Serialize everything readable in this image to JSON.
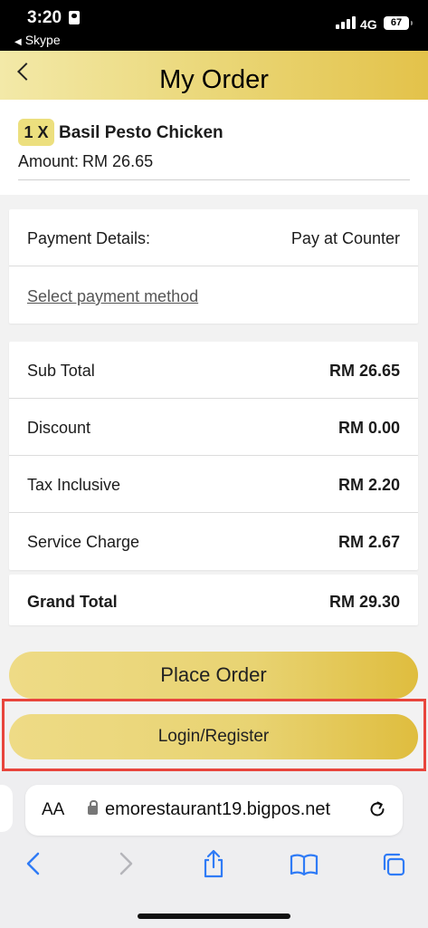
{
  "status_bar": {
    "time": "3:20",
    "back_app": "Skype",
    "network": "4G",
    "battery": "67"
  },
  "header": {
    "title": "My Order"
  },
  "order_item": {
    "quantity": "1 X",
    "name": "Basil Pesto Chicken",
    "amount_label": "Amount:",
    "amount_value": "RM 26.65"
  },
  "payment": {
    "label": "Payment Details:",
    "value": "Pay at Counter",
    "select_link": "Select payment method"
  },
  "summary": [
    {
      "label": "Sub Total",
      "value": "RM 26.65"
    },
    {
      "label": "Discount",
      "value": "RM 0.00"
    },
    {
      "label": "Tax Inclusive",
      "value": "RM 2.20"
    },
    {
      "label": "Service Charge",
      "value": "RM 2.67"
    }
  ],
  "grand_total": {
    "label": "Grand Total",
    "value": "RM 29.30"
  },
  "buttons": {
    "place_order": "Place Order",
    "login_register": "Login/Register"
  },
  "browser": {
    "text_size_label": "AA",
    "url": "emorestaurant19.bigpos.net"
  },
  "colors": {
    "gold_start": "#f3e9a8",
    "gold_end": "#e3c24a",
    "highlight": "#e8453c",
    "ios_blue": "#2f7bf6"
  }
}
